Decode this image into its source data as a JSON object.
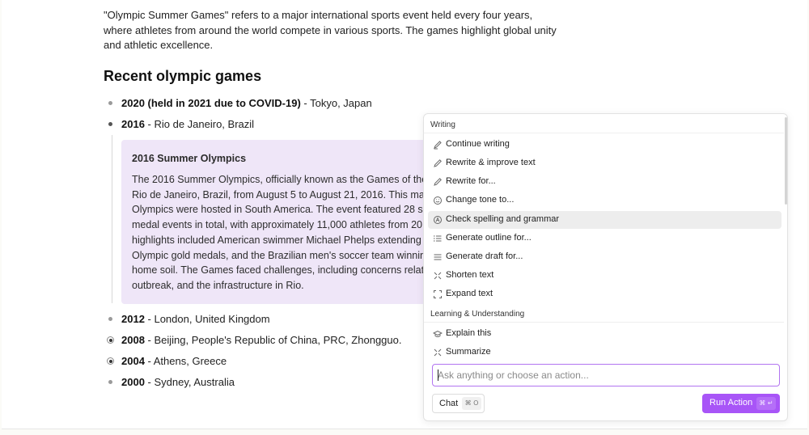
{
  "document": {
    "intro": "\"Olympic Summer Games\" refers to a major international sports event held every four years, where athletes from around the world compete in various sports. The games highlight global unity and athletic excellence.",
    "heading": "Recent olympic games",
    "games_top": [
      {
        "year": "2020 (held in 2021 due to COVID-19)",
        "place": " - Tokyo, Japan"
      },
      {
        "year": "2016",
        "place": " - Rio de Janeiro, Brazil"
      }
    ],
    "callout": {
      "title": "2016 Summer Olympics",
      "lines": [
        "The 2016 Summer Olympics, officially known as the Games of the",
        "Rio de Janeiro, Brazil, from August 5 to August 21, 2016. This mar",
        "Olympics were hosted in South America. The event featured 28 sp",
        "medal events in total, with approximately 11,000 athletes from 20",
        "highlights included American swimmer Michael Phelps extending",
        "Olympic gold medals, and the Brazilian men's soccer team winnin",
        "home soil. The Games faced challenges, including concerns relate",
        "outbreak, and the infrastructure in Rio."
      ]
    },
    "games_bottom": [
      {
        "year": "2012",
        "place": " - London, United Kingdom"
      },
      {
        "year": "2008",
        "place": " - Beijing, People's Republic of China, PRC, Zhongguo."
      },
      {
        "year": "2004",
        "place": " - Athens, Greece"
      },
      {
        "year": "2000",
        "place": " - Sydney, Australia"
      }
    ]
  },
  "ai_menu": {
    "sections": [
      {
        "title": "Writing",
        "items": [
          {
            "label": "Continue writing",
            "icon": "pen-icon"
          },
          {
            "label": "Rewrite & improve text",
            "icon": "pencil-icon"
          },
          {
            "label": "Rewrite for...",
            "icon": "pencil-icon"
          },
          {
            "label": "Change tone to...",
            "icon": "smile-icon"
          },
          {
            "label": "Check spelling and grammar",
            "icon": "spellcheck-icon",
            "active": true
          },
          {
            "label": "Generate outline for...",
            "icon": "list-icon"
          },
          {
            "label": "Generate draft for...",
            "icon": "lines-icon"
          },
          {
            "label": "Shorten text",
            "icon": "shrink-icon"
          },
          {
            "label": "Expand text",
            "icon": "expand-icon"
          }
        ]
      },
      {
        "title": "Learning & Understanding",
        "items": [
          {
            "label": "Explain this",
            "icon": "graduation-cap-icon"
          },
          {
            "label": "Summarize",
            "icon": "shrink-icon"
          }
        ]
      }
    ],
    "input_placeholder": "Ask anything or choose an action...",
    "chat_label": "Chat",
    "chat_shortcut": "⌘ O",
    "run_label": "Run Action",
    "run_shortcut": "⌘ ↵",
    "accent_color": "#a855f7"
  }
}
